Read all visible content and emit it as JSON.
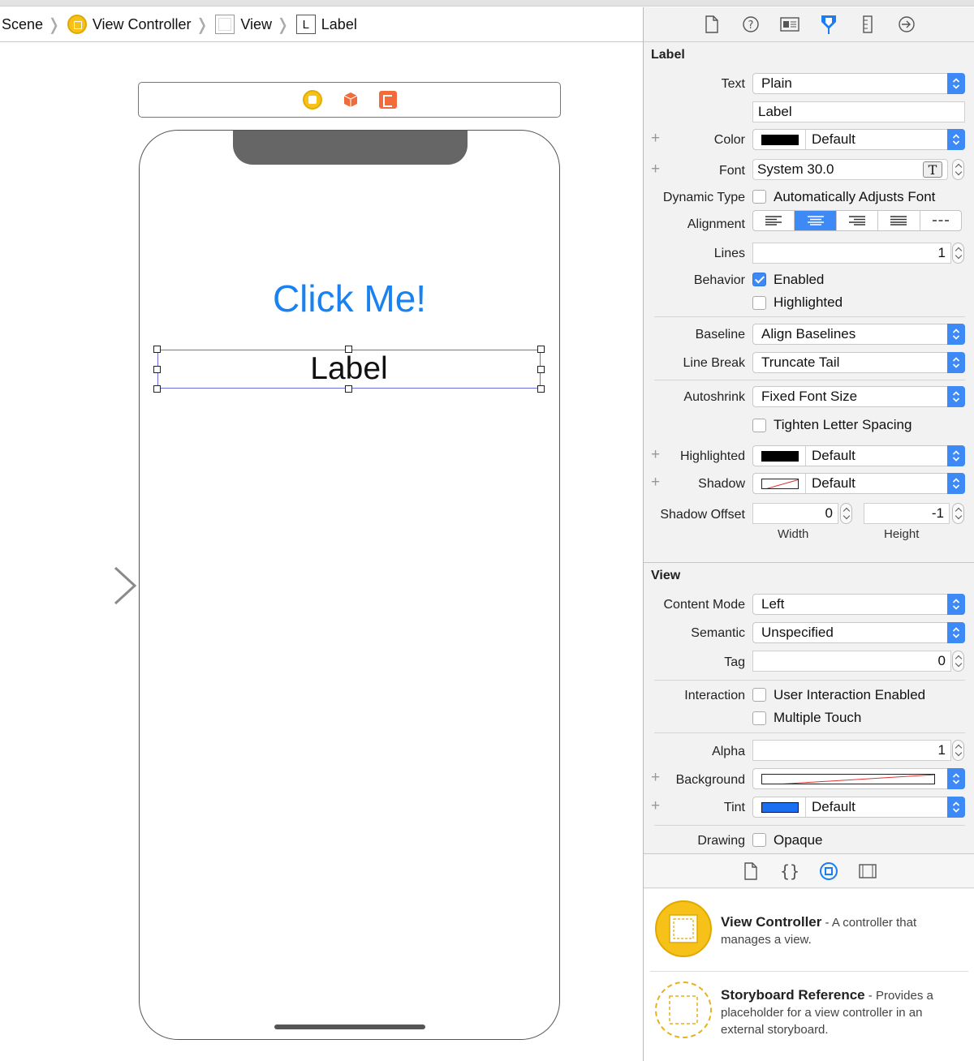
{
  "breadcrumb": {
    "items": [
      "Scene",
      "View Controller",
      "View",
      "Label"
    ],
    "label_icon_letter": "L"
  },
  "canvas": {
    "button_title": "Click Me!",
    "label_text": "Label",
    "button_color": "#1a82f0"
  },
  "inspector": {
    "tabs": [
      "file-icon",
      "help-icon",
      "identity-icon",
      "attributes-icon",
      "size-icon",
      "connections-icon"
    ],
    "label_section": {
      "title": "Label",
      "text_label": "Text",
      "text_value": "Plain",
      "text_field": "Label",
      "color_label": "Color",
      "color_value": "Default",
      "font_label": "Font",
      "font_value": "System 30.0",
      "dynamic_type_label": "Dynamic Type",
      "dynamic_type_option": "Automatically Adjusts Font",
      "alignment_label": "Alignment",
      "alignment_selected": "center",
      "lines_label": "Lines",
      "lines_value": "1",
      "behavior_label": "Behavior",
      "enabled_label": "Enabled",
      "enabled_checked": true,
      "highlighted_label": "Highlighted",
      "highlighted_checked": false,
      "baseline_label": "Baseline",
      "baseline_value": "Align Baselines",
      "line_break_label": "Line Break",
      "line_break_value": "Truncate Tail",
      "autoshrink_label": "Autoshrink",
      "autoshrink_value": "Fixed Font Size",
      "tighten_label": "Tighten Letter Spacing",
      "highlighted_color_label": "Highlighted",
      "highlighted_color_value": "Default",
      "shadow_label": "Shadow",
      "shadow_value": "Default",
      "shadow_offset_label": "Shadow Offset",
      "shadow_width_value": "0",
      "shadow_height_value": "-1",
      "width_caption": "Width",
      "height_caption": "Height"
    },
    "view_section": {
      "title": "View",
      "content_mode_label": "Content Mode",
      "content_mode_value": "Left",
      "semantic_label": "Semantic",
      "semantic_value": "Unspecified",
      "tag_label": "Tag",
      "tag_value": "0",
      "interaction_label": "Interaction",
      "user_interaction_label": "User Interaction Enabled",
      "multiple_touch_label": "Multiple Touch",
      "alpha_label": "Alpha",
      "alpha_value": "1",
      "background_label": "Background",
      "tint_label": "Tint",
      "tint_value": "Default",
      "tint_color": "#1a6ff0",
      "drawing_label": "Drawing",
      "opaque_label": "Opaque"
    }
  },
  "library": {
    "tabs": [
      "file-template-icon",
      "code-snippet-icon",
      "object-library-icon",
      "media-library-icon"
    ],
    "items": [
      {
        "name": "View Controller",
        "description": " - A controller that manages a view."
      },
      {
        "name": "Storyboard Reference",
        "description": " - Provides a placeholder for a view controller in an external storyboard."
      }
    ]
  }
}
